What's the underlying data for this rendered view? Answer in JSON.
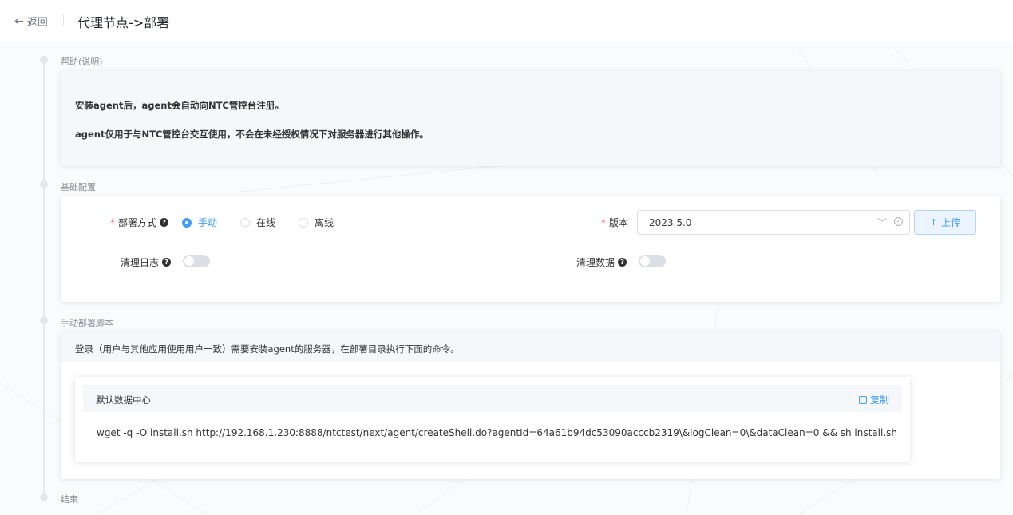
{
  "header": {
    "back_label": "返回",
    "title": "代理节点->部署"
  },
  "steps": {
    "help": "帮助(说明)",
    "basic": "基础配置",
    "manual_script": "手动部署脚本",
    "end": "结束"
  },
  "help": {
    "line1": "安装agent后，agent会自动向NTC管控台注册。",
    "line2": "agent仅用于与NTC管控台交互使用，不会在未经授权情况下对服务器进行其他操作。"
  },
  "config": {
    "deploy_method_label": "部署方式",
    "deploy_options": [
      "手动",
      "在线",
      "离线"
    ],
    "deploy_selected": "手动",
    "version_label": "版本",
    "version_value": "2023.5.0",
    "upload_label": "上传",
    "clean_log_label": "清理日志",
    "clean_log_on": false,
    "clean_data_label": "清理数据",
    "clean_data_on": false
  },
  "script": {
    "description": "登录（用户与其他应用使用用户一致）需要安装agent的服务器，在部署目录执行下面的命令。",
    "datacenter": "默认数据中心",
    "copy_label": "复制",
    "command": "wget -q -O install.sh http://192.168.1.230:8888/ntctest/next/agent/createShell.do?agentId=64a61b94dc53090acccb2319\\&logClean=0\\&dataClean=0 && sh install.sh"
  },
  "colors": {
    "accent": "#409eff",
    "required": "#f56c6c",
    "panel_bg": "#f5f7fa"
  }
}
